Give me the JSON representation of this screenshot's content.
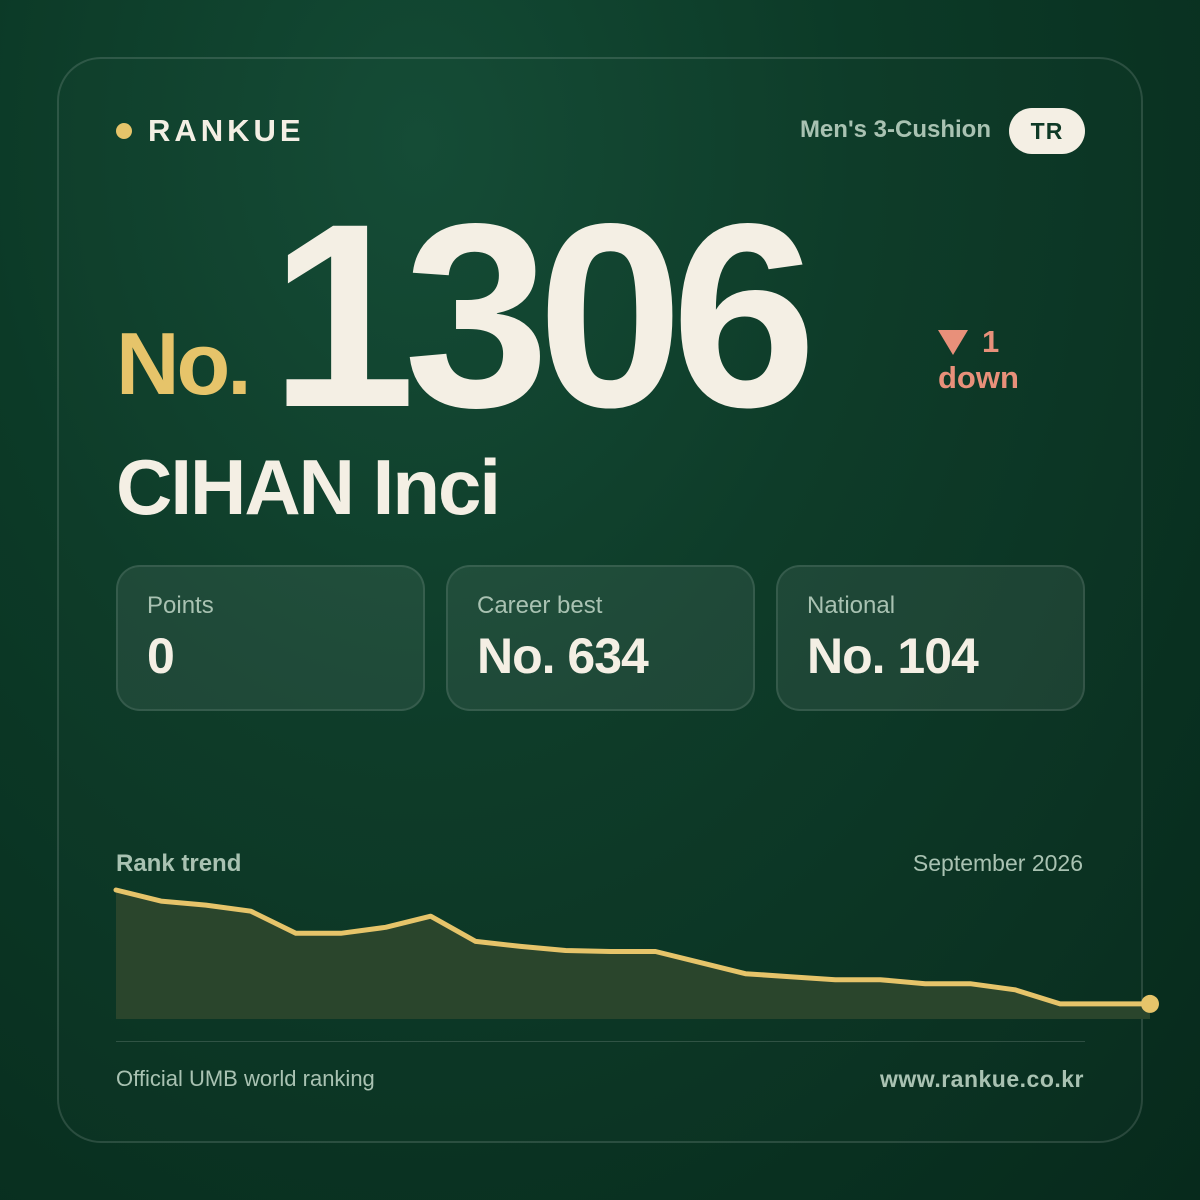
{
  "brand": {
    "name": "RANKUE",
    "accent": "#e6c46a"
  },
  "header": {
    "category": "Men's 3-Cushion",
    "country": "TR"
  },
  "rank": {
    "prefix": "No.",
    "number": "1306",
    "change_amount": "1",
    "change_word": "down",
    "change_direction": "down",
    "change_color": "#e8907a"
  },
  "player": {
    "name": "CIHAN Inci"
  },
  "stats": [
    {
      "label": "Points",
      "value": "0"
    },
    {
      "label": "Career best",
      "value": "No. 634"
    },
    {
      "label": "National",
      "value": "No. 104"
    }
  ],
  "trend": {
    "title": "Rank trend",
    "date": "September 2026"
  },
  "footer": {
    "source": "Official UMB world ranking",
    "url": "www.rankue.co.kr"
  },
  "chart_data": {
    "type": "area",
    "title": "Rank trend",
    "xlabel": "",
    "ylabel": "",
    "grid": false,
    "y_values": [
      128,
      117,
      113,
      107,
      85,
      85,
      91,
      102,
      77,
      72,
      68,
      67,
      67,
      56,
      45,
      42,
      39,
      39,
      35,
      35,
      29,
      15,
      15,
      15
    ],
    "y_range": [
      0,
      130
    ],
    "line_color": "#e6c46a",
    "fill_color": "#2a452c"
  }
}
